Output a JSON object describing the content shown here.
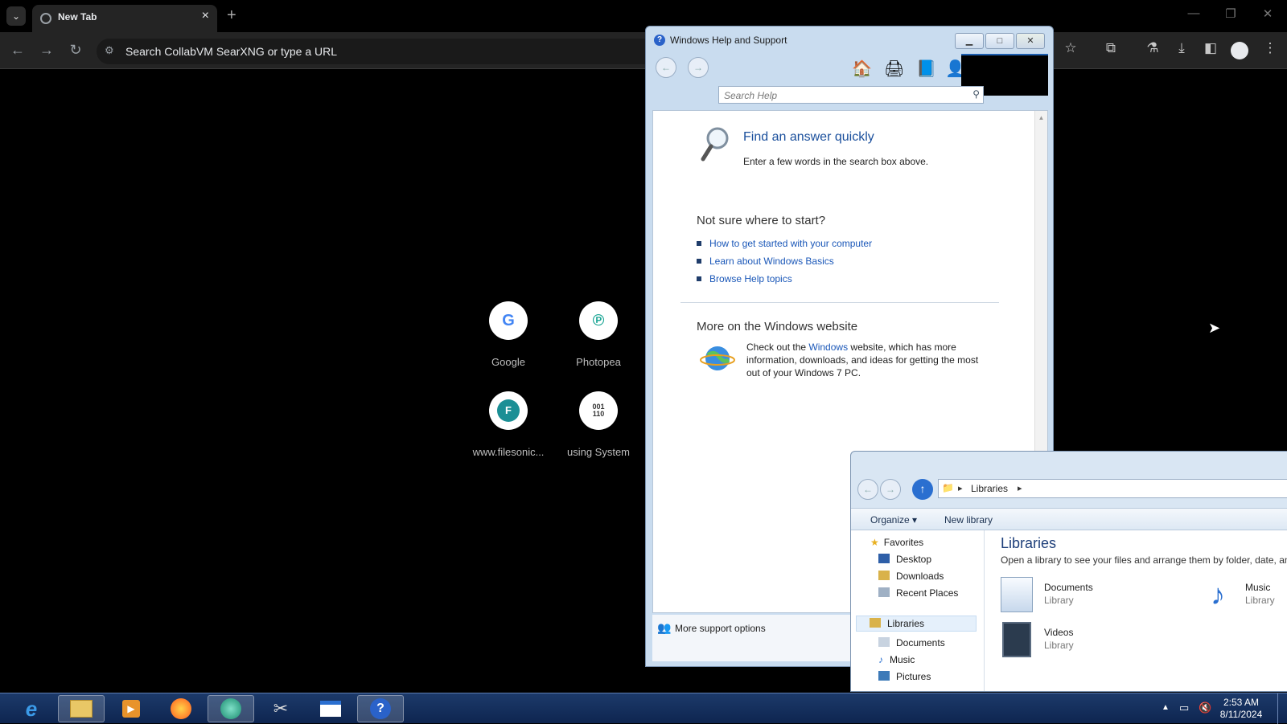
{
  "browser": {
    "tab_title": "New Tab",
    "omnibox_placeholder": "Search CollabVM SearXNG or type a URL",
    "shortcuts": [
      {
        "label": "Google",
        "glyph": "G",
        "color": "#4285f4"
      },
      {
        "label": "Photopea",
        "glyph": "P",
        "color": "#17a493"
      },
      {
        "label": "www.filesonic...",
        "glyph": "F",
        "color": "#1b8f95"
      },
      {
        "label": "using System",
        "glyph": "001\n110",
        "color": "#333333"
      }
    ]
  },
  "help_window": {
    "title": "Windows Help and Support",
    "search_placeholder": "Search Help",
    "heading": "Find an answer quickly",
    "heading_desc": "Enter a few words in the search box above.",
    "start_heading": "Not sure where to start?",
    "links": [
      "How to get started with your computer",
      "Learn about Windows Basics",
      "Browse Help topics"
    ],
    "more_heading": "More on the Windows website",
    "more_text_before": "Check out the ",
    "more_link": "Windows",
    "more_text_after": " website, which has more information, downloads, and ideas for getting the most out of your Windows 7 PC.",
    "footer_label": "More support options"
  },
  "explorer": {
    "breadcrumb": "Libraries",
    "organize_label": "Organize",
    "new_library_label": "New library",
    "nav_favorites": "Favorites",
    "nav_fav_items": [
      "Desktop",
      "Downloads",
      "Recent Places"
    ],
    "nav_libraries": "Libraries",
    "nav_lib_items": [
      "Documents",
      "Music",
      "Pictures"
    ],
    "main_title": "Libraries",
    "main_desc": "Open a library to see your files and arrange them by folder, date, and",
    "libraries": [
      {
        "name": "Documents",
        "type": "Library"
      },
      {
        "name": "Music",
        "type": "Library"
      },
      {
        "name": "Videos",
        "type": "Library"
      }
    ]
  },
  "taskbar": {
    "time": "2:53 AM",
    "date": "8/11/2024",
    "apps": [
      "internet-explorer-icon",
      "file-explorer-icon",
      "media-player-icon",
      "firefox-icon",
      "browser-icon",
      "snipping-tool-icon",
      "window-icon",
      "help-icon"
    ]
  }
}
